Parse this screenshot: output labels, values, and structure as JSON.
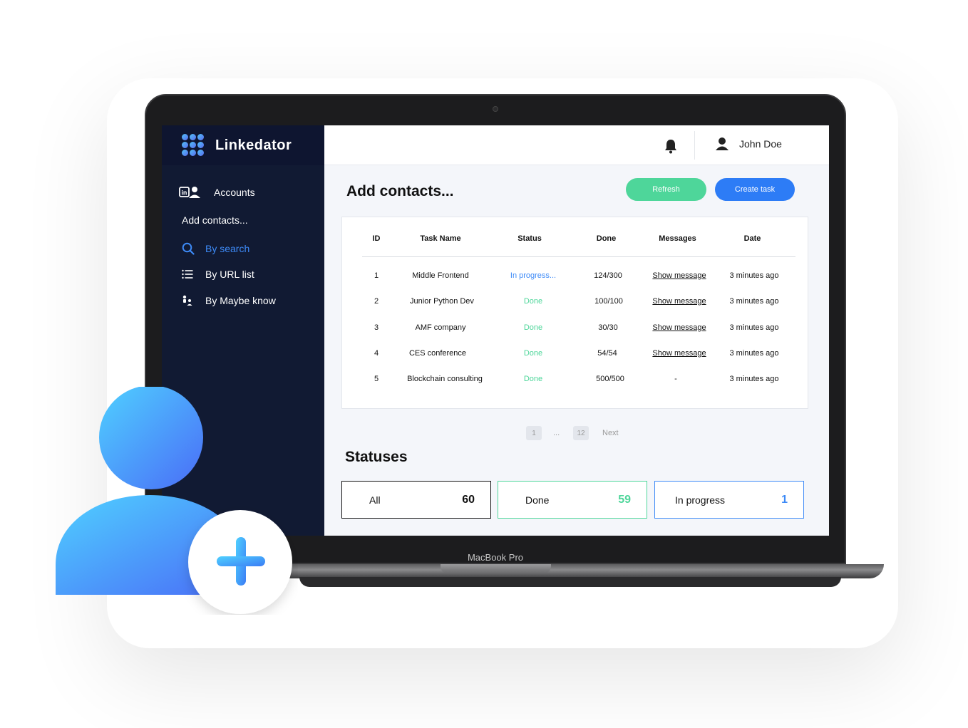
{
  "app": {
    "name": "Linkedator"
  },
  "device_label": "MacBook Pro",
  "sidebar": {
    "accounts": "Accounts",
    "section": "Add contacts...",
    "items": [
      {
        "label": "By search",
        "icon": "search-icon",
        "active": true
      },
      {
        "label": "By URL list",
        "icon": "list-icon",
        "active": false
      },
      {
        "label": "By Maybe know",
        "icon": "people-icon",
        "active": false
      }
    ]
  },
  "header": {
    "user_name": "John Doe"
  },
  "main": {
    "title": "Add contacts...",
    "refresh_label": "Refresh",
    "create_label": "Create task"
  },
  "table": {
    "columns": [
      "ID",
      "Task Name",
      "Status",
      "Done",
      "Messages",
      "Date"
    ],
    "rows": [
      {
        "id": "1",
        "name": "Middle Frontend",
        "status": "In progress...",
        "done": "124/300",
        "messages": "Show message",
        "date": "3 minutes ago"
      },
      {
        "id": "2",
        "name": "Junior Python Dev",
        "status": "Done",
        "done": "100/100",
        "messages": "Show message",
        "date": "3 minutes ago"
      },
      {
        "id": "3",
        "name": "AMF company",
        "status": "Done",
        "done": "30/30",
        "messages": "Show message",
        "date": "3 minutes ago"
      },
      {
        "id": "4",
        "name": "CES conference",
        "status": "Done",
        "done": "54/54",
        "messages": "Show message",
        "date": "3 minutes ago"
      },
      {
        "id": "5",
        "name": "Blockchain consulting",
        "status": "Done",
        "done": "500/500",
        "messages": "-",
        "date": "3 minutes ago"
      }
    ]
  },
  "pagination": {
    "first": "1",
    "ellipsis": "...",
    "last": "12",
    "next": "Next"
  },
  "statuses": {
    "title": "Statuses",
    "all_label": "All",
    "all_value": "60",
    "done_label": "Done",
    "done_value": "59",
    "progress_label": "In progress",
    "progress_value": "1"
  },
  "colors": {
    "sidebar": "#111a33",
    "accent_blue": "#2d7cf6",
    "accent_green": "#4ed69a"
  }
}
